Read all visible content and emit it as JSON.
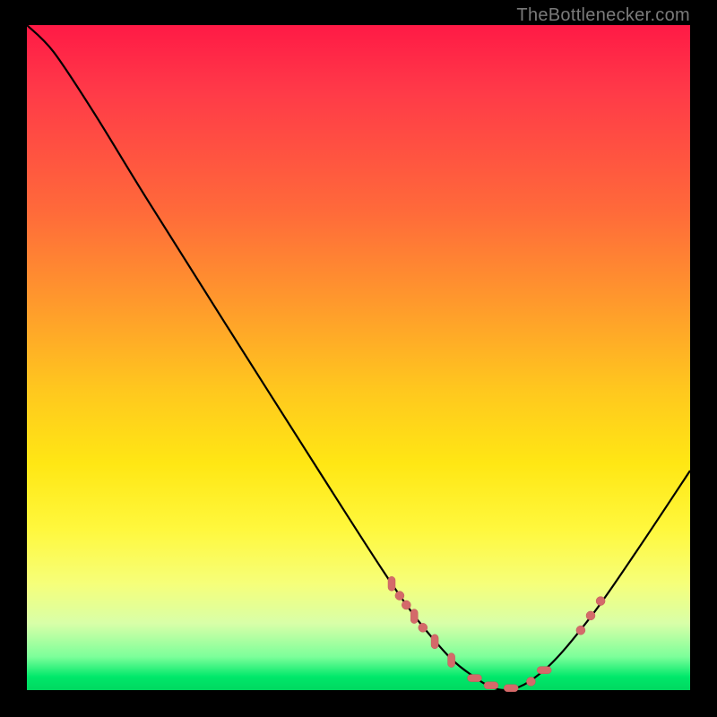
{
  "watermark": "TheBottlenecker.com",
  "chart_data": {
    "type": "line",
    "title": "",
    "xlabel": "",
    "ylabel": "",
    "xlim": [
      0,
      100
    ],
    "ylim": [
      0,
      100
    ],
    "gradient_colors": {
      "top": "#ff1a46",
      "mid_upper": "#ff9a2c",
      "mid": "#ffe714",
      "mid_lower": "#d8ffa8",
      "bottom": "#00d860"
    },
    "series": [
      {
        "name": "bottleneck-curve",
        "x": [
          0,
          4,
          10,
          18,
          30,
          44,
          55,
          61,
          66,
          72,
          78,
          85,
          92,
          100
        ],
        "y": [
          100,
          96,
          87,
          74,
          55,
          33,
          16,
          8,
          3,
          0,
          3,
          11,
          21,
          33
        ]
      }
    ],
    "markers": {
      "name": "highlighted-points",
      "points": [
        {
          "x": 55.0,
          "y": 16.0,
          "shape": "pill"
        },
        {
          "x": 56.2,
          "y": 14.2,
          "shape": "dot"
        },
        {
          "x": 57.2,
          "y": 12.8,
          "shape": "dot"
        },
        {
          "x": 58.4,
          "y": 11.1,
          "shape": "pill"
        },
        {
          "x": 59.7,
          "y": 9.4,
          "shape": "dot"
        },
        {
          "x": 61.5,
          "y": 7.3,
          "shape": "pill"
        },
        {
          "x": 64.0,
          "y": 4.5,
          "shape": "pill"
        },
        {
          "x": 67.5,
          "y": 1.8,
          "shape": "pill-h"
        },
        {
          "x": 70.0,
          "y": 0.7,
          "shape": "pill-h"
        },
        {
          "x": 73.0,
          "y": 0.3,
          "shape": "pill-h"
        },
        {
          "x": 76.0,
          "y": 1.3,
          "shape": "dot"
        },
        {
          "x": 78.0,
          "y": 3.0,
          "shape": "pill-h"
        },
        {
          "x": 83.5,
          "y": 9.0,
          "shape": "dot"
        },
        {
          "x": 85.0,
          "y": 11.2,
          "shape": "dot"
        },
        {
          "x": 86.5,
          "y": 13.4,
          "shape": "dot"
        }
      ]
    }
  }
}
